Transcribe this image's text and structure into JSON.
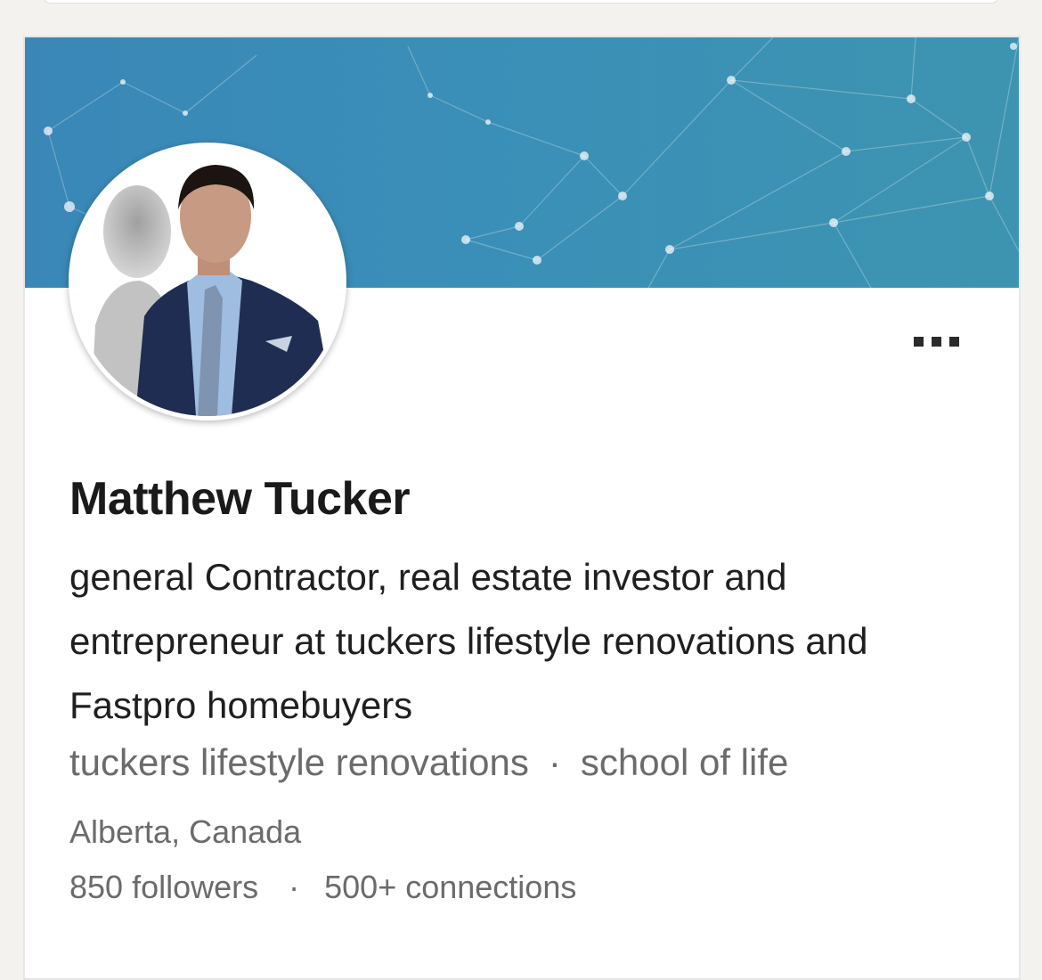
{
  "profile": {
    "name": "Matthew Tucker",
    "headline": "general Contractor, real estate investor and entrepreneur at tuckers lifestyle renovations and Fastpro homebuyers",
    "company": "tuckers lifestyle renovations",
    "school": "school of life",
    "location": "Alberta, Canada",
    "followers": "850 followers",
    "connections": "500+ connections",
    "separator": "·"
  },
  "icons": {
    "more": "more-options-icon"
  },
  "colors": {
    "banner": "#3a8fb8",
    "name_text": "#1a1a1a",
    "secondary_text": "#6b6b6b"
  }
}
